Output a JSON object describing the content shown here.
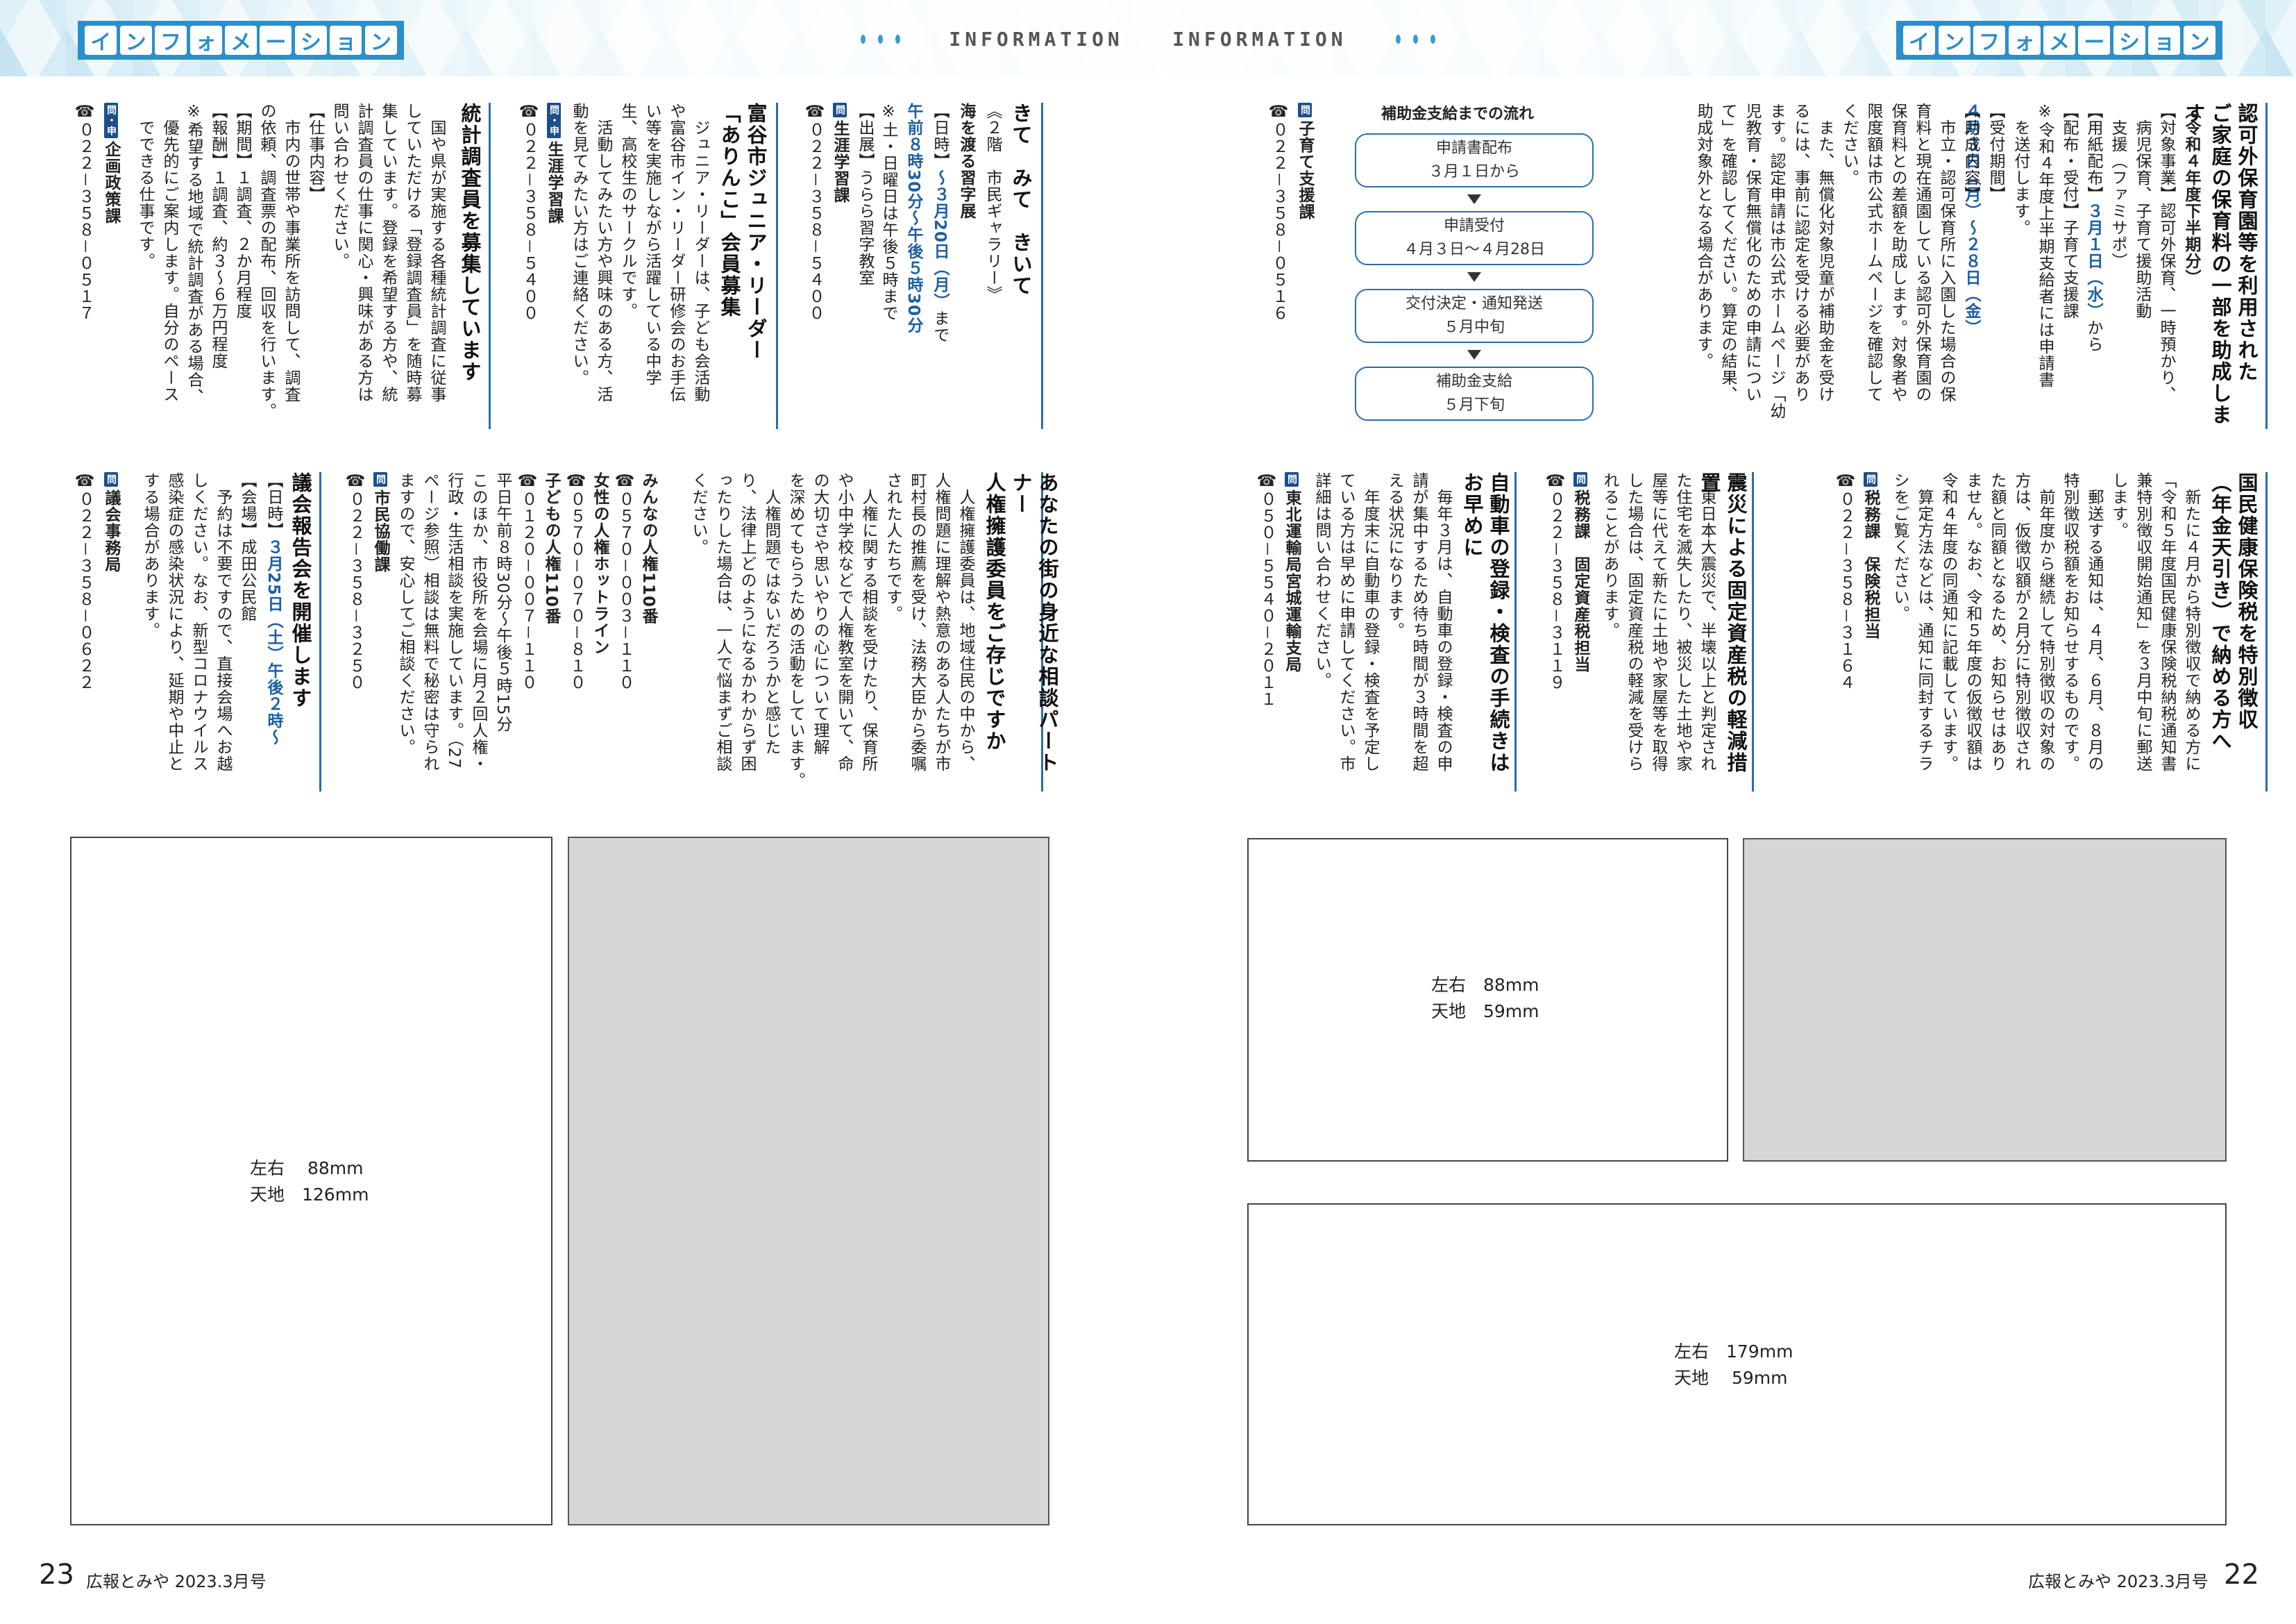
{
  "header": {
    "left_badge": [
      "イ",
      "ン",
      "フ",
      "ォ",
      "メ",
      "ー",
      "シ",
      "ョ",
      "ン"
    ],
    "right_badge": [
      "イ",
      "ン",
      "フ",
      "ォ",
      "メ",
      "ー",
      "シ",
      "ョ",
      "ン"
    ],
    "center_left": "INFORMATION",
    "center_right": "INFORMATION"
  },
  "ask_badge": "問",
  "ask_apply_badge": "問・申",
  "right_page": {
    "a1": {
      "title": "認可外保育園等を利用された\nご家庭の保育料の一部を助成します",
      "subtitle": "（令和４年度下半期分）",
      "body1": "【対象事業】認可外保育、一時預かり、\n　病児保育、子育て援助活動\n　支援（ファミサポ）",
      "dist_label": "【用紙配布】",
      "dist_date": "３月１日（水）",
      "dist_after": "から",
      "body2": "【配布・受付】子育て支援課\n※令和４年度上半期支給者には申請書\n　を送付します。",
      "recv_label": "【受付期間】",
      "recv_date": "４月３日（月）～２８日（金）",
      "body3": "【助成内容】\n　市立・認可保育所に入園した場合の保\n育料と現在通園している認可外保育園の\n保育料との差額を助成します。対象者や\n限度額は市公式ホームページを確認して\nください。\n　また、無償化対象児童が補助金を受け\nるには、事前に認定を受ける必要があり\nます。認定申請は市公式ホームページ「幼\n児教育・保育無償化のための申請につい\nて」を確認してください。算定の結果、\n助成対象外となる場合があります。",
      "flow_title": "補助金支給までの流れ",
      "flow": [
        {
          "label": "申請書配布",
          "date": "３月１日から"
        },
        {
          "label": "申請受付",
          "date": "４月３日～４月28日"
        },
        {
          "label": "交付決定・通知発送",
          "date": "５月中旬"
        },
        {
          "label": "補助金支給",
          "date": "５月下旬"
        }
      ],
      "contact_dept": "子育て支援課",
      "contact_tel": "☎０２２－３５８－０５１６"
    },
    "a2": {
      "title": "国民健康保険税を特別徴収\n（年金天引き）で納める方へ",
      "body": "　新たに４月から特別徴収で納める方に\n「令和５年度国民健康保険税納税通知書\n兼特別徴収開始通知」を３月中旬に郵送\nします。\n　郵送する通知は、４月、６月、８月の\n特別徴収税額をお知らせするものです。\n　前年度から継続して特別徴収の対象の\n方は、仮徴収額が２月分に特別徴収され\nた額と同額となるため、お知らせはあり\nません。なお、令和５年度の仮徴収額は\n令和４年度の同通知に記載しています。\n　算定方法などは、通知に同封するチラ\nシをご覧ください。",
      "contact_dept": "税務課　保険税担当",
      "contact_tel": "☎０２２－３５８－３１６４"
    },
    "a3": {
      "title": "震災による固定資産税の軽減措置",
      "body": "　東日本大震災で、半壊以上と判定され\nた住宅を滅失したり、被災した土地や家\n屋等に代えて新たに土地や家屋等を取得\nした場合は、固定資産税の軽減を受けら\nれることがあります。",
      "contact_dept": "税務課　固定資産税担当",
      "contact_tel": "☎０２２－３５８－３１１９"
    },
    "a4": {
      "title": "自動車の登録・検査の手続きは\nお早めに",
      "body": "　毎年３月は、自動車の登録・検査の申\n請が集中するため待ち時間が３時間を超\nえる状況になります。\n　年度末に自動車の登録・検査を予定し\nている方は早めに申請してください。市\n詳細は問い合わせください。",
      "contact_dept": "東北運輸局宮城運輸支局",
      "contact_tel": "☎０５０－５５４０－２０１１"
    },
    "ads": {
      "ad1": [
        "左右　88mm",
        "天地　59mm"
      ],
      "ad3": [
        "左右　179mm",
        "天地　 59mm"
      ]
    }
  },
  "left_page": {
    "b1": {
      "title": "きて　みて　きいて",
      "sub": "《２階　市民ギャラリー》",
      "event": "海を渡る習字展",
      "date_label": "【日時】",
      "date": "～３月20日（月）",
      "date_after": "まで",
      "time": "午前８時30分～午後５時30分",
      "note": "※土・日曜日は午後５時まで",
      "body": "【出展】うらら習字教室",
      "contact_dept": "生涯学習課",
      "contact_tel": "☎０２２－３５８－５４００"
    },
    "b2": {
      "title": "富谷市ジュニア・リーダー\n「ありんこ」会員募集",
      "body": "　ジュニア・リーダーは、子ども会活動\nや富谷市イン・リーダー研修会のお手伝\nい等を実施しながら活躍している中学\n生、高校生のサークルです。\n　活動してみたい方や興味のある方、活\n動を見てみたい方はご連絡ください。",
      "contact_dept": "生涯学習課",
      "contact_tel": "☎０２２－３５８－５４００"
    },
    "b3": {
      "title": "統計調査員を募集しています",
      "body": "　国や県が実施する各種統計調査に従事\nしていただける「登録調査員」を随時募\n集しています。登録を希望する方や、統\n計調査員の仕事に関心・興味がある方は\n問い合わせください。\n【仕事内容】\n　市内の世帯や事業所を訪問して、調査\nの依頼、調査票の配布、回収を行います。\n【期間】１調査、２か月程度\n【報酬】１調査、約３～６万円程度\n※希望する地域で統計調査がある場合、\n　優先的にご案内します。自分のペース\n　でできる仕事です。",
      "contact_dept": "企画政策課",
      "contact_tel": "☎０２２－３５８－０５１７"
    },
    "b4": {
      "title": "あなたの街の身近な相談パートナー\n人権擁護委員をご存じですか",
      "body": "　人権擁護委員は、地域住民の中から、\n人権問題に理解や熱意のある人たちが市\n町村長の推薦を受け、法務大臣から委嘱\nされた人たちです。\n　人権に関する相談を受けたり、保育所\nや小中学校などで人権教室を開いて、命\nの大切さや思いやりの心について理解\nを深めてもらうための活動をしています。\n　人権問題ではないだろうかと感じた\nり、法律上どのようになるかわからず困\nったりした場合は、一人で悩まずご相談\nください。",
      "lines": [
        {
          "name": "みんなの人権110番",
          "tel": "☎０５７０－００３－１１０"
        },
        {
          "name": "女性の人権ホットライン",
          "tel": "☎０５７０－０７０－８１０"
        },
        {
          "name": "子どもの人権110番",
          "tel": "☎０１２０－００７－１１０"
        }
      ],
      "hours": "平日午前８時30分～午後５時15分\nこのほか、市役所を会場に月２回人権・\n行政・生活相談を実施しています。（27\nページ参照）相談は無料で秘密は守られ\nますので、安心してご相談ください。",
      "contact_dept": "市民協働課",
      "contact_tel": "☎０２２－３５８－３２５０"
    },
    "b5": {
      "title": "議会報告会を開催します",
      "date_label": "【日時】",
      "date": "３月25日（土）午後２時～",
      "body": "【会場】成田公民館\n　予約は不要ですので、直接会場へお越\nしください。なお、新型コロナウイルス\n感染症の感染状況により、延期や中止と\nする場合があります。",
      "contact_dept": "議会事務局",
      "contact_tel": "☎０２２－３５８－０６２２"
    },
    "ads": {
      "ad1": [
        "左右　 88mm",
        "天地　126mm"
      ]
    }
  },
  "footer": {
    "left_num": "23",
    "left_text": "広報とみや 2023.3月号",
    "right_text": "広報とみや 2023.3月号",
    "right_num": "22"
  },
  "colors": {
    "accent": "#2b8fc9",
    "highlight": "#1d5fa3",
    "ask_badge": "#1d4f8c"
  }
}
